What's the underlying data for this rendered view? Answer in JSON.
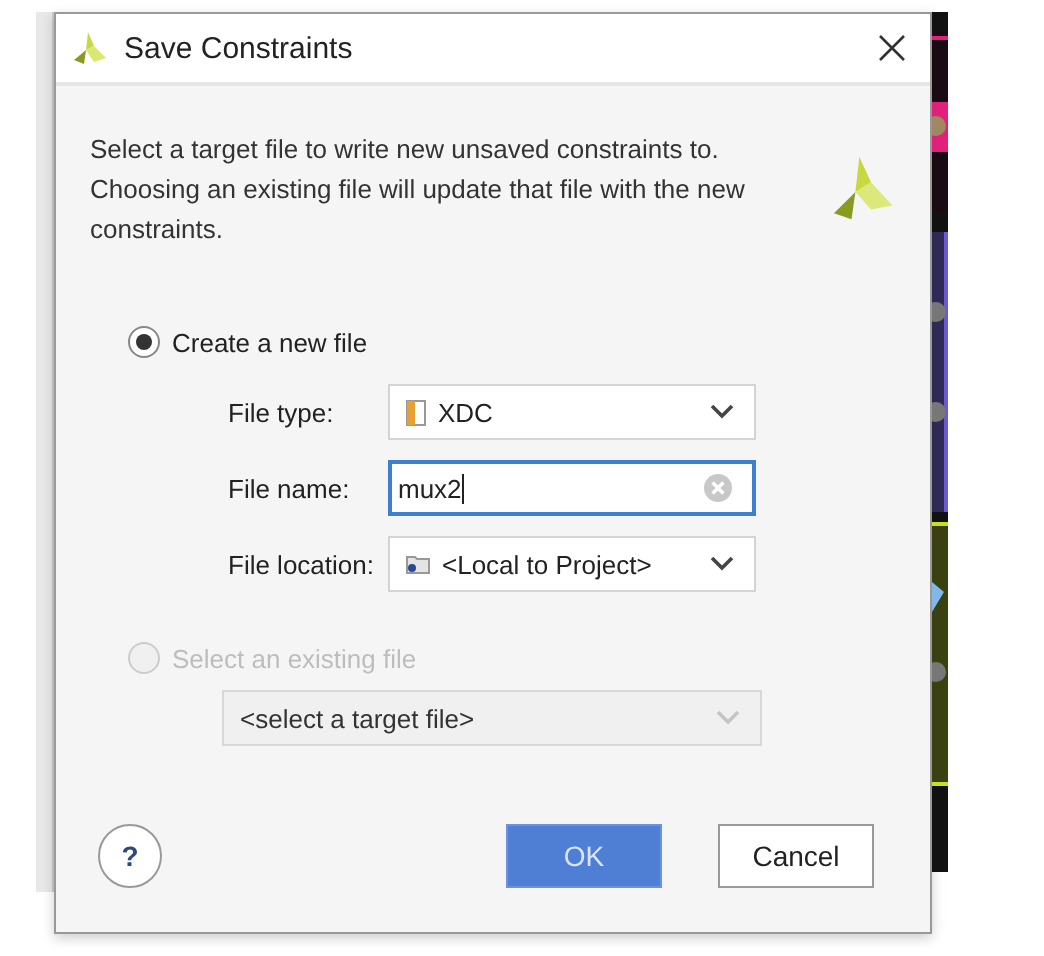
{
  "dialog": {
    "title": "Save Constraints",
    "description": "Select a target file to write new unsaved constraints to. Choosing an existing file will update that file with the new constraints.",
    "options": [
      {
        "label": "Create a new file",
        "selected": true,
        "disabled": false,
        "fields": [
          {
            "kind": "file-type",
            "label": "File type:",
            "value": "XDC"
          },
          {
            "kind": "text",
            "label": "File name:",
            "value": "mux2",
            "focused": true
          },
          {
            "kind": "location",
            "label": "File location:",
            "value": "<Local to Project>"
          }
        ]
      },
      {
        "label": "Select an existing file",
        "selected": false,
        "disabled": true,
        "fields": [
          {
            "kind": "target",
            "value": "<select a target file>"
          }
        ]
      }
    ],
    "buttons": [
      {
        "kind": "help",
        "label": "?"
      },
      {
        "kind": "primary",
        "label": "OK"
      },
      {
        "kind": "default",
        "label": "Cancel"
      }
    ]
  }
}
